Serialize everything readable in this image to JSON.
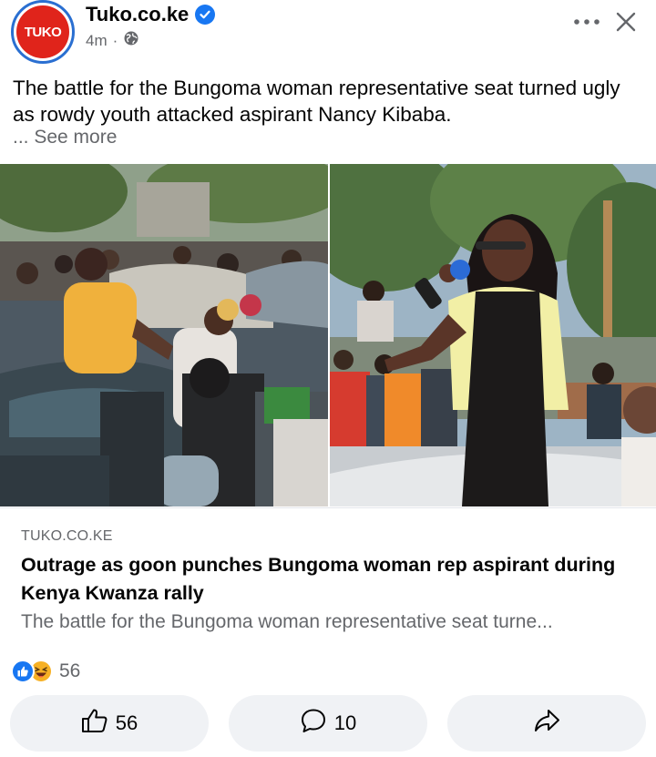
{
  "post": {
    "page_name": "Tuko.co.ke",
    "avatar_text": "TUKO",
    "time": "4m",
    "separator": "·",
    "caption": "The battle for the Bungoma woman representative seat turned ugly as rowdy youth attacked aspirant Nancy Kibaba.",
    "see_more": "... See more"
  },
  "link": {
    "domain": "TUKO.CO.KE",
    "title": "Outrage as goon punches Bungoma woman rep aspirant during Kenya Kwanza rally",
    "description": "The battle for the Bungoma woman representative seat turne..."
  },
  "reactions": {
    "count": "56"
  },
  "actions": {
    "like_count": "56",
    "comment_count": "10"
  },
  "colors": {
    "brand_red": "#e0241b",
    "facebook_blue": "#1877f2",
    "haha_yellow": "#f7b125",
    "button_bg": "#f0f2f5",
    "secondary_text": "#65676b"
  },
  "icons": {
    "verified": "verified-badge-icon",
    "globe": "globe-icon",
    "more": "more-options-icon",
    "close": "close-icon",
    "like": "thumbs-up-icon",
    "comment": "comment-icon",
    "share": "share-icon"
  }
}
